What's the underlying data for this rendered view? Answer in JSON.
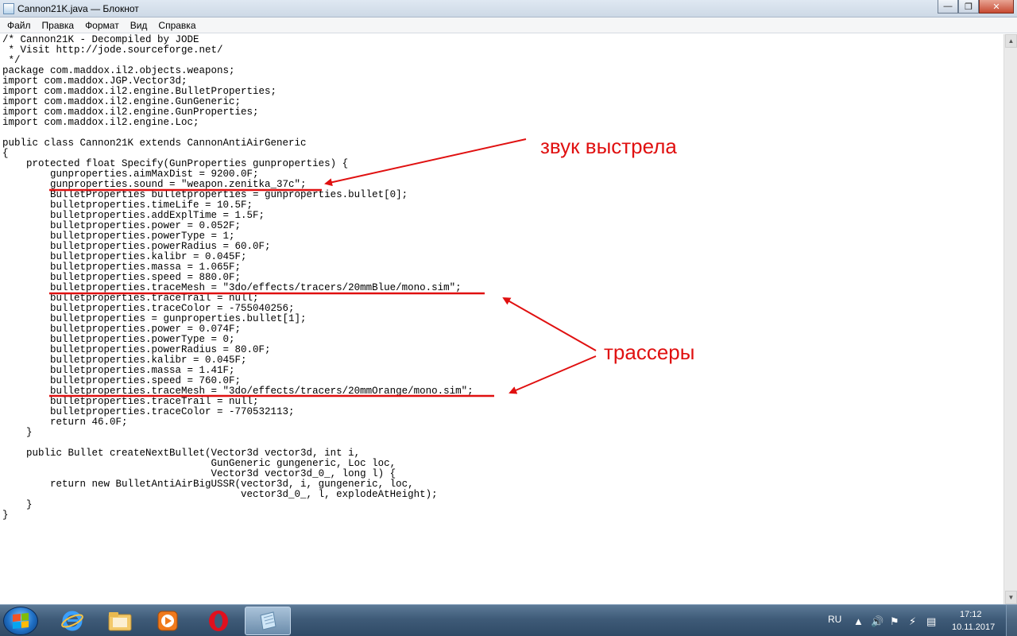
{
  "window": {
    "title": "Cannon21K.java — Блокнот"
  },
  "menu": [
    "Файл",
    "Правка",
    "Формат",
    "Вид",
    "Справка"
  ],
  "code_lines": [
    "/* Cannon21K - Decompiled by JODE",
    " * Visit http://jode.sourceforge.net/",
    " */",
    "package com.maddox.il2.objects.weapons;",
    "import com.maddox.JGP.Vector3d;",
    "import com.maddox.il2.engine.BulletProperties;",
    "import com.maddox.il2.engine.GunGeneric;",
    "import com.maddox.il2.engine.GunProperties;",
    "import com.maddox.il2.engine.Loc;",
    "",
    "public class Cannon21K extends CannonAntiAirGeneric",
    "{",
    "    protected float Specify(GunProperties gunproperties) {",
    "        gunproperties.aimMaxDist = 9200.0F;",
    "        gunproperties.sound = \"weapon.zenitka_37c\";",
    "        BulletProperties bulletproperties = gunproperties.bullet[0];",
    "        bulletproperties.timeLife = 10.5F;",
    "        bulletproperties.addExplTime = 1.5F;",
    "        bulletproperties.power = 0.052F;",
    "        bulletproperties.powerType = 1;",
    "        bulletproperties.powerRadius = 60.0F;",
    "        bulletproperties.kalibr = 0.045F;",
    "        bulletproperties.massa = 1.065F;",
    "        bulletproperties.speed = 880.0F;",
    "        bulletproperties.traceMesh = \"3do/effects/tracers/20mmBlue/mono.sim\";",
    "        bulletproperties.traceTrail = null;",
    "        bulletproperties.traceColor = -755040256;",
    "        bulletproperties = gunproperties.bullet[1];",
    "        bulletproperties.power = 0.074F;",
    "        bulletproperties.powerType = 0;",
    "        bulletproperties.powerRadius = 80.0F;",
    "        bulletproperties.kalibr = 0.045F;",
    "        bulletproperties.massa = 1.41F;",
    "        bulletproperties.speed = 760.0F;",
    "        bulletproperties.traceMesh = \"3do/effects/tracers/20mmOrange/mono.sim\";",
    "        bulletproperties.traceTrail = null;",
    "        bulletproperties.traceColor = -770532113;",
    "        return 46.0F;",
    "    }",
    "",
    "    public Bullet createNextBullet(Vector3d vector3d, int i,",
    "                                   GunGeneric gungeneric, Loc loc,",
    "                                   Vector3d vector3d_0_, long l) {",
    "        return new BulletAntiAirBigUSSR(vector3d, i, gungeneric, loc,",
    "                                        vector3d_0_, l, explodeAtHeight);",
    "    }",
    "}"
  ],
  "annotations": {
    "sound_label": "звук выстрела",
    "tracers_label": "трассеры",
    "color": "#e01010"
  },
  "taskbar": {
    "language": "RU",
    "time": "17:12",
    "date": "10.11.2017",
    "apps": [
      "explorer-icon",
      "media-player-icon",
      "opera-icon",
      "notepad-icon"
    ]
  }
}
